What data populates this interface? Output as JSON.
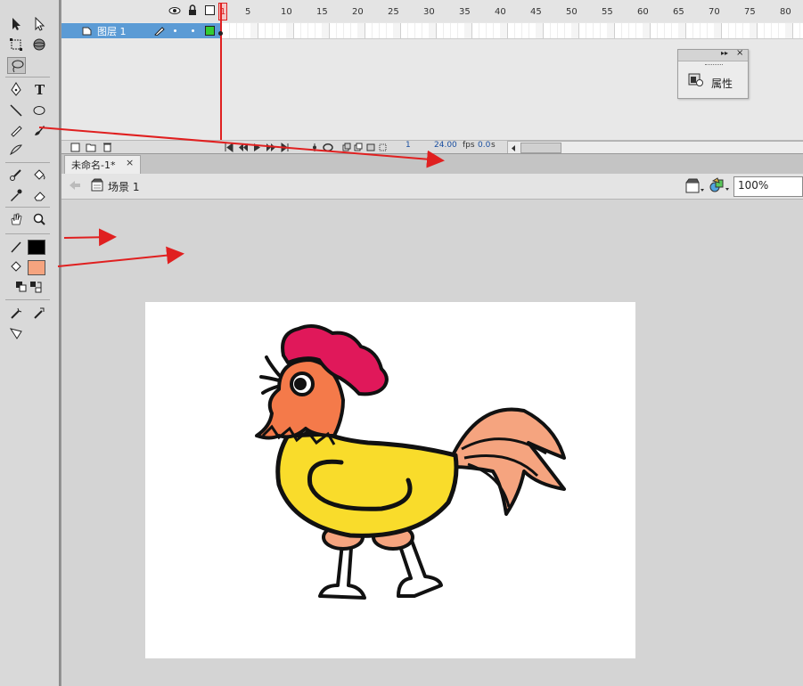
{
  "timeline": {
    "layer_name": "图层 1",
    "ruler_numbers": [
      "1",
      "5",
      "10",
      "15",
      "20",
      "25",
      "30",
      "35",
      "40",
      "45",
      "50",
      "55",
      "60",
      "65",
      "70",
      "75",
      "80"
    ],
    "current_frame": "1",
    "fps": "24.00",
    "fps_unit": "fps",
    "time": "0.0",
    "time_unit": "s"
  },
  "properties_panel": {
    "label": "属性"
  },
  "document": {
    "tab_label": "未命名-1*",
    "tab_close": "×",
    "scene_label": "场景 1",
    "zoom": "100%"
  },
  "colors": {
    "stroke_color": "#000000",
    "fill_color": "#f5a47f",
    "layer_highlight": "#5b9bd5",
    "annotation_arrow": "#e02020"
  },
  "toolbox": {
    "tools": [
      "selection-tool",
      "subselection-tool",
      "free-transform-tool",
      "3d-rotation-tool",
      "lasso-tool",
      "pen-tool",
      "text-tool",
      "line-tool",
      "oval-tool",
      "pencil-tool",
      "brush-tool",
      "deco-tool",
      "bone-tool",
      "paint-bucket-tool",
      "eyedropper-tool",
      "eraser-tool",
      "hand-tool",
      "zoom-tool",
      "stroke-color-tool",
      "fill-color-tool",
      "swap-colors-tool",
      "snap-tool",
      "smooth-tool",
      "straighten-tool"
    ]
  }
}
